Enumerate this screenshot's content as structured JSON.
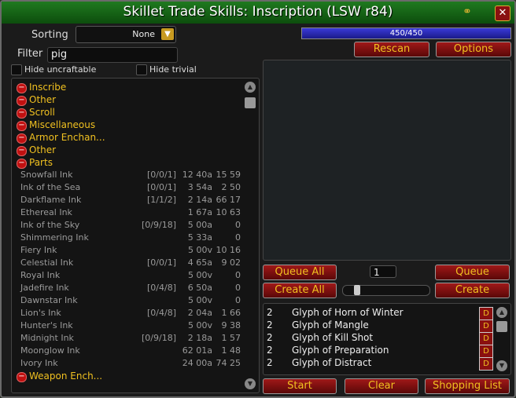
{
  "window": {
    "title": "Skillet Trade Skills: Inscription (LSW r84)"
  },
  "sorting": {
    "label": "Sorting",
    "value": "None"
  },
  "filter": {
    "label": "Filter",
    "value": "pig"
  },
  "checkboxes": {
    "hide_uncraftable": "Hide uncraftable",
    "hide_trivial": "Hide trivial"
  },
  "skill": {
    "text": "450/450",
    "fraction": 1.0,
    "color": "#2a2ac0"
  },
  "buttons": {
    "rescan": "Rescan",
    "options": "Options",
    "queue_all": "Queue All",
    "queue": "Queue",
    "create_all": "Create All",
    "create": "Create",
    "start": "Start",
    "clear": "Clear",
    "shopping_list": "Shopping List"
  },
  "quantity": {
    "value": "1"
  },
  "headers": [
    "Inscribe",
    "Other",
    "Scroll",
    "Miscellaneous",
    "Armor Enchan...",
    "Other",
    "Parts"
  ],
  "items": [
    {
      "name": "Snowfall Ink",
      "count": "[0/0/1]",
      "stat1": "12 40a",
      "stat2": "15 59"
    },
    {
      "name": "Ink of the Sea",
      "count": "[0/0/1]",
      "stat1": "3 54a",
      "stat2": "2 50"
    },
    {
      "name": "Darkflame Ink",
      "count": "[1/1/2]",
      "stat1": "2 14a",
      "stat2": "66 17"
    },
    {
      "name": "Ethereal Ink",
      "count": "",
      "stat1": "1 67a",
      "stat2": "10 63"
    },
    {
      "name": "Ink of the Sky",
      "count": "[0/9/18]",
      "stat1": "5 00a",
      "stat2": "0"
    },
    {
      "name": "Shimmering Ink",
      "count": "",
      "stat1": "5 33a",
      "stat2": "0"
    },
    {
      "name": "Fiery Ink",
      "count": "",
      "stat1": "5 00v",
      "stat2": "10 16"
    },
    {
      "name": "Celestial Ink",
      "count": "[0/0/1]",
      "stat1": "4 65a",
      "stat2": "9 02"
    },
    {
      "name": "Royal Ink",
      "count": "",
      "stat1": "5 00v",
      "stat2": "0"
    },
    {
      "name": "Jadefire Ink",
      "count": "[0/4/8]",
      "stat1": "6 50a",
      "stat2": "0"
    },
    {
      "name": "Dawnstar Ink",
      "count": "",
      "stat1": "5 00v",
      "stat2": "0"
    },
    {
      "name": "Lion's Ink",
      "count": "[0/4/8]",
      "stat1": "2 04a",
      "stat2": "1 66"
    },
    {
      "name": "Hunter's Ink",
      "count": "",
      "stat1": "5 00v",
      "stat2": "9 38"
    },
    {
      "name": "Midnight Ink",
      "count": "[0/9/18]",
      "stat1": "2 18a",
      "stat2": "1 57"
    },
    {
      "name": "Moonglow Ink",
      "count": "",
      "stat1": "62 01a",
      "stat2": "1 48"
    },
    {
      "name": "Ivory Ink",
      "count": "",
      "stat1": "24 00a",
      "stat2": "74 25"
    }
  ],
  "footer_header": "Weapon Ench...",
  "queue": [
    {
      "num": "2",
      "name": "Glyph of Horn of Winter",
      "del": "D"
    },
    {
      "num": "2",
      "name": "Glyph of Mangle",
      "del": "D"
    },
    {
      "num": "2",
      "name": "Glyph of Kill Shot",
      "del": "D"
    },
    {
      "num": "2",
      "name": "Glyph of Preparation",
      "del": "D"
    },
    {
      "num": "2",
      "name": "Glyph of Distract",
      "del": "D"
    }
  ]
}
